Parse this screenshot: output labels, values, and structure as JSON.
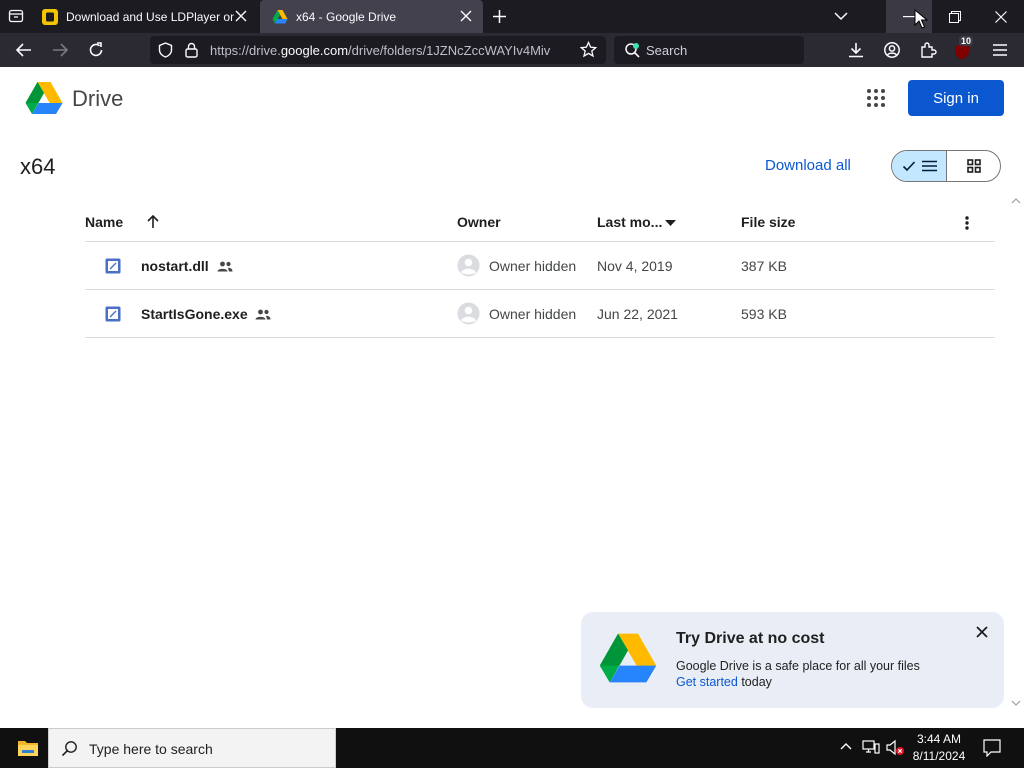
{
  "browser": {
    "tabs": [
      {
        "title": "Download and Use LDPlayer on"
      },
      {
        "title": "x64 - Google Drive"
      }
    ],
    "url_prefix": "https://drive.",
    "url_host": "google.com",
    "url_rest": "/drive/folders/1JZNcZccWAYIv4Miv",
    "search_placeholder": "Search",
    "extension_badge": "10"
  },
  "drive": {
    "brand": "Drive",
    "sign_in_label": "Sign in",
    "folder_title": "x64",
    "download_all_label": "Download all",
    "columns": {
      "name": "Name",
      "owner": "Owner",
      "modified": "Last mo...",
      "size": "File size"
    },
    "files": [
      {
        "name": "nostart.dll",
        "owner": "Owner hidden",
        "modified": "Nov 4, 2019",
        "size": "387 KB"
      },
      {
        "name": "StartIsGone.exe",
        "owner": "Owner hidden",
        "modified": "Jun 22, 2021",
        "size": "593 KB"
      }
    ]
  },
  "promo": {
    "title": "Try Drive at no cost",
    "body": "Google Drive is a safe place for all your files",
    "link": "Get started",
    "link_suffix": " today"
  },
  "taskbar": {
    "search_placeholder": "Type here to search",
    "time": "3:44 AM",
    "date": "8/11/2024"
  },
  "colors": {
    "accent": "#0b57d0",
    "selected_toggle": "#c2e7ff",
    "chrome_dark": "#1c1b22",
    "promo_bg": "#e9eef6"
  }
}
